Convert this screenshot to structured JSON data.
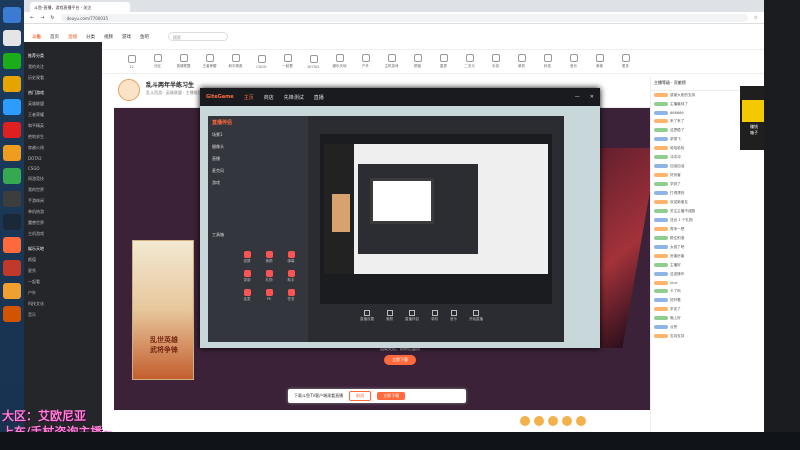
{
  "browser": {
    "tab_title": "斗鱼-直播，游戏直播平台 - 关注",
    "url": "douyu.com/7700035"
  },
  "nav": {
    "logo": "斗鱼",
    "items": [
      "首页",
      "直播",
      "分类",
      "视频",
      "游戏",
      "鱼吧"
    ],
    "search_placeholder": "搜索"
  },
  "categories": [
    "12",
    "分区",
    "英雄联盟",
    "王者荣耀",
    "和平精英",
    "CSGO",
    "一起看",
    "DOTA2",
    "娱乐天地",
    "户外",
    "主机游戏",
    "颜值",
    "星秀",
    "二次元",
    "手游",
    "单机",
    "科技",
    "音乐",
    "美食",
    "更多"
  ],
  "sidebar": {
    "items": [
      "推荐分类",
      "我的关注",
      "历史观看",
      "热门游戏",
      "英雄联盟",
      "王者荣耀",
      "和平精英",
      "绝地求生",
      "穿越火线",
      "DOTA2",
      "CSGO",
      "网游竞技",
      "我的世界",
      "手游休闲",
      "单机热游",
      "魔兽世界",
      "主机游戏",
      "娱乐天地",
      "颜值",
      "星秀",
      "一起看",
      "户外",
      "科技文化",
      "音乐"
    ]
  },
  "stream": {
    "title": "乱斗两年半练习生",
    "subtitle": "乱斗西游 · 英雄联盟 · 主播推荐"
  },
  "gamebox": {
    "brand": "GiteGame",
    "tabs": [
      "主页",
      "商店",
      "先锋测试",
      "直播"
    ],
    "obs_title": "直播伴侣",
    "obs_items": [
      "场景1",
      "摄像头",
      "直播",
      "麦克风",
      "游戏"
    ],
    "tools_label": "工具箱",
    "tools": [
      "投屏",
      "美颜",
      "弹幕",
      "录制",
      "礼物",
      "助手",
      "连麦",
      "PK",
      "任务"
    ],
    "bottom": [
      "直播设置",
      "美颜",
      "直播伴侣",
      "录制",
      "音乐",
      "开始直播"
    ]
  },
  "poster": {
    "title": "乱世英雄\n武将争锋"
  },
  "promo": {
    "text": "加载失败，刷新后重试",
    "button": "立即下载"
  },
  "toast": {
    "text": "下载斗鱼TV客户端观看直播",
    "cancel": "取消",
    "confirm": "立即下载"
  },
  "chat": {
    "header": "主播等级 · 贡献榜",
    "rows": [
      "感谢大佬的支持",
      "主播最帅了",
      "666666",
      "来了来了",
      "这把稳了",
      "求带飞",
      "哈哈哈哈",
      "冲冲冲",
      "加油加油",
      "好厉害",
      "学到了",
      "打得漂亮",
      "欢迎新朋友",
      "关注主播不迷路",
      "送出 1 个礼物",
      "再来一把",
      "稳住别浪",
      "太强了吧",
      "厉害厉害",
      "主播好",
      "这波操作",
      "nice",
      "卡了吗",
      "好好看",
      "辛苦了",
      "晚上好",
      "点赞",
      "支持支持"
    ]
  },
  "overlay": {
    "line1": "大区：艾欧尼亚",
    "line2": "上车/手杖咨询主播~"
  },
  "ad": {
    "text": "赚钱\n箱子"
  }
}
